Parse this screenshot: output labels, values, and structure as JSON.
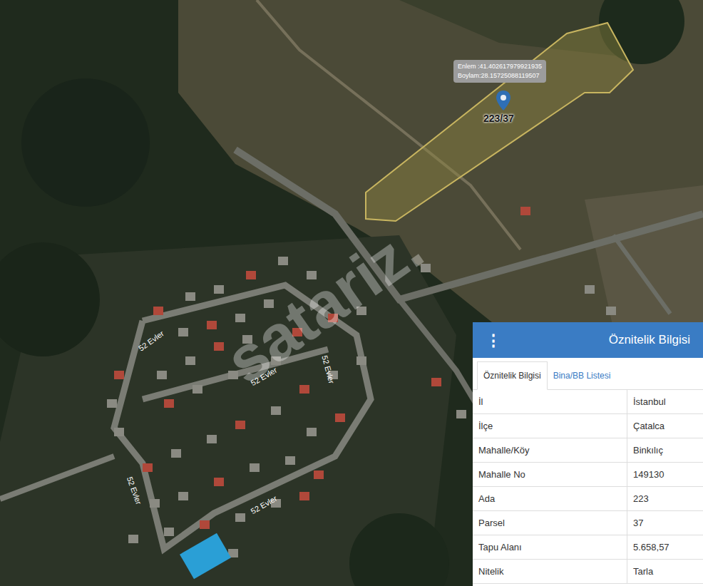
{
  "map": {
    "tooltip": {
      "lines": [
        "Enlem :41.402617979921935",
        "Boylam:28.15725088119507"
      ]
    },
    "parcel_label": "223/37",
    "street_labels": [
      "52 Evler",
      "52 Evler",
      "52 Evler",
      "52 Evler",
      "52 Evler"
    ],
    "watermark": "satariz."
  },
  "panel": {
    "menu_icon": "⋮",
    "title": "Öznitelik Bilgisi",
    "tabs": [
      {
        "label": "Öznitelik Bilgisi",
        "selected": true
      },
      {
        "label": "Bina/BB Listesi",
        "selected": false
      }
    ],
    "rows": [
      {
        "key": "İl",
        "value": "İstanbul"
      },
      {
        "key": "İlçe",
        "value": "Çatalca"
      },
      {
        "key": "Mahalle/Köy",
        "value": "Binkılıç"
      },
      {
        "key": "Mahalle No",
        "value": "149130"
      },
      {
        "key": "Ada",
        "value": "223"
      },
      {
        "key": "Parsel",
        "value": "37"
      },
      {
        "key": "Tapu Alanı",
        "value": "5.658,57"
      },
      {
        "key": "Nitelik",
        "value": "Tarla"
      }
    ]
  }
}
